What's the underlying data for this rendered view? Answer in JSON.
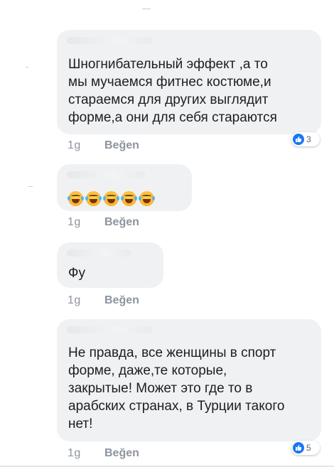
{
  "comments": [
    {
      "text": "Шногнибательный эффект ,а то\nмы мучаемся фитнес костюме,и\nстараемся для других выглядит\nформе,а они для себя стараются",
      "time": "1g",
      "like_label": "Beğen",
      "reaction_count": "3"
    },
    {
      "emoji_names": [
        "tears-of-joy-emoji",
        "tears-of-joy-emoji",
        "tears-of-joy-emoji",
        "tears-of-joy-emoji",
        "tears-of-joy-emoji"
      ],
      "time": "1g",
      "like_label": "Beğen"
    },
    {
      "text": "Фу",
      "time": "1g",
      "like_label": "Beğen"
    },
    {
      "text": "Не правда, все женщины в спорт\nформе, даже,те которые,\nзакрытые! Может это где то в\nарабских странах, в Турции такого\nнет!",
      "time": "1g",
      "like_label": "Beğen",
      "reaction_count": "5"
    }
  ],
  "colors": {
    "bubble": "#f0f1f3",
    "meta_text": "#8d949e",
    "like_blue": "#1877f2"
  }
}
